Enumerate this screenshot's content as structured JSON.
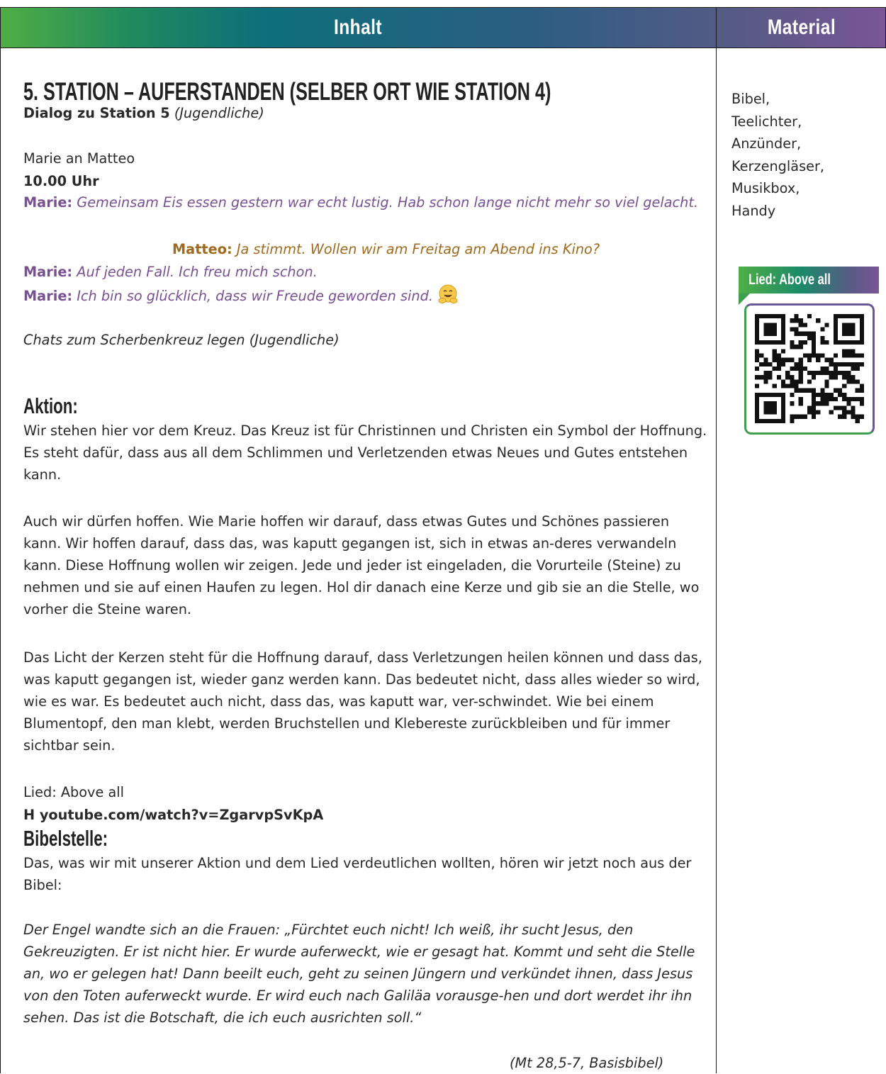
{
  "header": {
    "inhalt": "Inhalt",
    "material": "Material"
  },
  "station": {
    "title": "5. STATION – AUFERSTANDEN (SELBER ORT WIE STATION 4)",
    "dialog_label": "Dialog zu Station 5",
    "dialog_who": "(Jugendliche)",
    "chat_from": "Marie an Matteo",
    "time": "10.00 Uhr",
    "msg1_name": "Marie:",
    "msg1_text": "Gemeinsam Eis essen gestern war echt lustig. Hab schon lange nicht mehr so viel gelacht.",
    "msg2_name": "Matteo:",
    "msg2_text": "Ja stimmt. Wollen wir am Freitag am Abend ins Kino?",
    "msg3_name": "Marie:",
    "msg3_text": "Auf jeden Fall. Ich freu mich schon.",
    "msg4_name": "Marie:",
    "msg4_text": "Ich bin so glücklich, dass wir Freude geworden sind.",
    "chats_note": "Chats zum Scherbenkreuz legen (Jugendliche)"
  },
  "aktion": {
    "heading": "Aktion:",
    "p1": "Wir stehen hier vor dem Kreuz. Das Kreuz ist für Christinnen und Christen ein Symbol der Hoffnung. Es steht dafür, dass aus all dem Schlimmen und Verletzenden etwas Neues und Gutes entstehen kann.",
    "p2": "Auch wir dürfen hoffen. Wie Marie hoffen wir darauf, dass etwas Gutes und Schönes passieren kann. Wir hoffen darauf, dass das, was kaputt gegangen ist, sich in etwas an-deres verwandeln kann. Diese Hoffnung wollen wir zeigen. Jede und jeder ist eingeladen, die Vorurteile (Steine) zu nehmen und sie auf einen Haufen zu legen. Hol dir danach eine Kerze und gib sie an die Stelle, wo vorher die Steine waren.",
    "p3": "Das Licht der Kerzen steht für die Hoffnung darauf, dass Verletzungen heilen können und dass das, was kaputt gegangen ist, wieder ganz werden kann. Das bedeutet nicht, dass alles wieder so wird, wie es war. Es bedeutet auch nicht, dass das, was kaputt war, ver-schwindet. Wie bei einem Blumentopf, den man klebt, werden Bruchstellen und Klebereste zurückbleiben und für immer sichtbar sein.",
    "song": "Lied: Above all",
    "link": "H youtube.com/watch?v=ZgarvpSvKpA"
  },
  "bibel": {
    "heading": "Bibelstelle:",
    "intro": "Das, was wir mit unserer Aktion und dem Lied verdeutlichen wollten, hören wir jetzt noch aus der Bibel:",
    "quote": "Der Engel wandte sich an die Frauen: „Fürchtet euch nicht! Ich weiß, ihr sucht Jesus, den Gekreuzigten. Er ist nicht hier. Er wurde auferweckt, wie er gesagt hat. Kommt und seht die Stelle an, wo er gelegen hat! Dann beeilt euch, geht zu seinen Jüngern und verkündet ihnen, dass Jesus von den Toten auferweckt wurde. Er wird euch nach Galiläa vorausge-hen und dort werdet ihr ihn sehen. Das ist die Botschaft, die ich euch ausrichten soll.“",
    "reference": "(Mt 28,5-7, Basisbibel)"
  },
  "material": {
    "items": [
      "Bibel,",
      "Teelichter,",
      "Anzünder,",
      "Kerzengläser,",
      "Musikbox,",
      "Handy"
    ],
    "qr_label": "Lied: Above all"
  },
  "icons": {
    "emoji": "hugging-face-icon",
    "qr": "qr-code-icon"
  },
  "colors": {
    "marie": "#7b4f94",
    "matteo": "#a06a1e"
  }
}
